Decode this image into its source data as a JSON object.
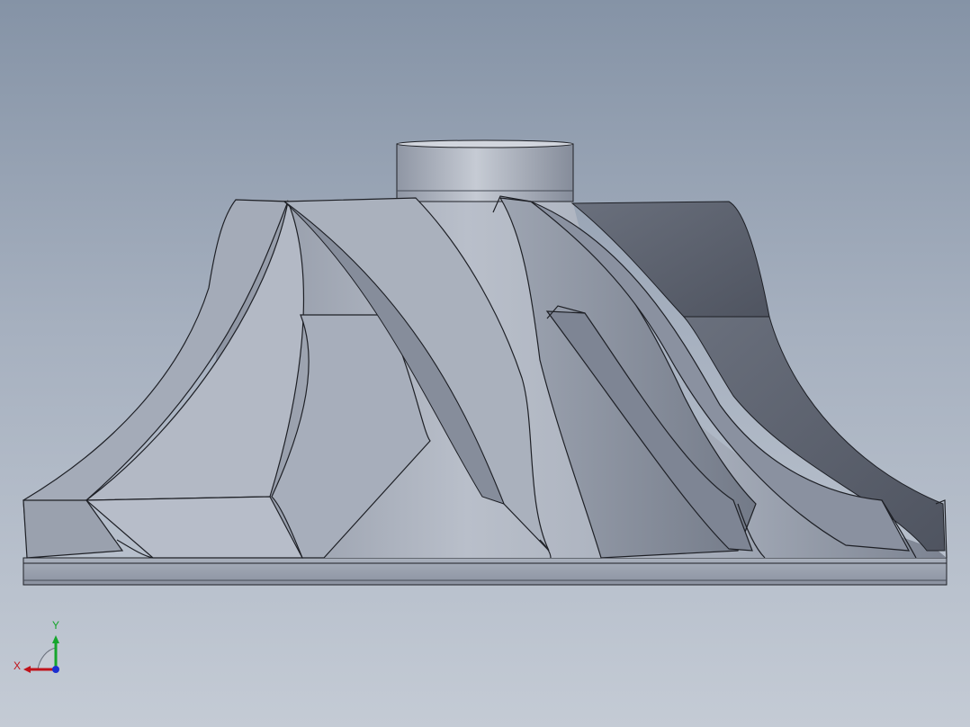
{
  "viewport": {
    "background_top": "#8593a6",
    "background_bottom": "#c4cbd5"
  },
  "model": {
    "description_icon": "impeller-model",
    "shade_light": "#b4bac6",
    "shade_mid": "#969ead",
    "shade_dark": "#5d6270",
    "edge": "#1e2026"
  },
  "triad": {
    "x_label": "X",
    "y_label": "Y",
    "x_color": "#c0131b",
    "y_color": "#15a52c",
    "z_color": "#1c2fd0"
  }
}
